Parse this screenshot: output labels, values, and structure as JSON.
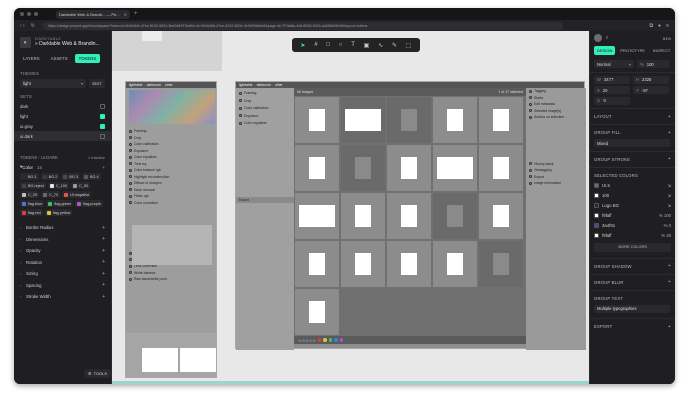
{
  "browser": {
    "tab_title": "Darktable Web & Brandi... — Pe...",
    "url": "https://design.penpot.app/#/workspace?team-id=0b3a3b6-47ee-8102-8004-3be0d9937bafile-id=0b3a3b6-47ee-8102-8004-4e3d99bfcbf4&page-id=7f7da8a-4e8-8005-8004-a4658b0fe0b&layout=tokens"
  },
  "project": {
    "org": "DARKTABLE",
    "name": "» Darktable Web & Brandin..."
  },
  "left_tabs": [
    "LAYERS",
    "ASSETS",
    "TOKENS"
  ],
  "themes": {
    "label": "THEMES",
    "selected": "light",
    "edit": "EDIT"
  },
  "sets": {
    "label": "SETS",
    "items": [
      {
        "name": "dark",
        "checked": false
      },
      {
        "name": "light",
        "checked": true
      },
      {
        "name": "ui.gray",
        "checked": true
      },
      {
        "name": "ui.dark",
        "checked": false
      }
    ]
  },
  "tokens": {
    "label": "TOKENS - UI.DARK",
    "state": "Inactive",
    "color_group": "Color",
    "color_count": "15",
    "pills": [
      {
        "name": "BG.1",
        "color": "#2b2b2b"
      },
      {
        "name": "BG.2",
        "color": "#3a3a3a"
      },
      {
        "name": "BG.3",
        "color": "#4a4a4a"
      },
      {
        "name": "BG.4",
        "color": "#5a5a5a"
      },
      {
        "name": "BG.reject",
        "color": "#444444"
      },
      {
        "name": "C_100",
        "color": "#e8e8e8"
      },
      {
        "name": "C_50",
        "color": "#9a9a9a"
      },
      {
        "name": "C_25",
        "color": "#c0c0c0"
      },
      {
        "name": "C_70",
        "color": "#6a6a6a"
      },
      {
        "name": "UI.negative",
        "color": "#e25555"
      },
      {
        "name": "flag.blue",
        "color": "#3f7ce0"
      },
      {
        "name": "flag.green",
        "color": "#3ec25a"
      },
      {
        "name": "flag.purple",
        "color": "#b44fd6"
      },
      {
        "name": "flag.red",
        "color": "#e03d3d"
      },
      {
        "name": "flag.yellow",
        "color": "#e0c23d"
      }
    ],
    "groups": [
      "Border Radius",
      "Dimensions",
      "Opacity",
      "Rotation",
      "Sizing",
      "Spacing",
      "Stroke Width"
    ]
  },
  "tools_button": "TOOLS",
  "canvas": {
    "toolbar_icons": [
      "pointer-icon",
      "frame-icon",
      "rect-icon",
      "ellipse-icon",
      "text-icon",
      "image-icon",
      "curve-icon",
      "path-icon",
      "plugin-icon"
    ],
    "left_panel_modules": [
      "Framing",
      "Crop",
      "Color calibration",
      "Exposure",
      "Color equalizer",
      "Tone eq.",
      "Color balance rgb",
      "Highlight reconstruction",
      "Diffuse or sharpen",
      "Haze removal",
      "Filmic rgb",
      "Color correction",
      "Composite",
      "Denoise (profiled)",
      "Lens correction",
      "White balance",
      "Raw black/white point"
    ],
    "right_panel_modules": [
      "Tagging",
      "Styles",
      "Edit metadata",
      "Selected image[s]",
      "Actions on selection",
      "History stack",
      "Geotagging",
      "Export",
      "Image information"
    ],
    "grid_header": "1 of 17 selected",
    "image_count_label": "All images",
    "export_label": "Export"
  },
  "right_panel": {
    "zoom": "81%",
    "tabs": [
      "DESIGN",
      "PROTOTYPE",
      "INSPECT"
    ],
    "layout_mode": "Normal",
    "opacity": "100",
    "w": "3477",
    "h": "2328",
    "x": "20",
    "y": "-97",
    "rotation": "0",
    "layout_header": "LAYOUT",
    "fill_header": "GROUP FILL",
    "fill_value": "Mixed",
    "stroke_header": "GROUP STROKE",
    "selected_colors_header": "SELECTED COLORS",
    "colors": [
      {
        "name": "UI.5",
        "color": "#6b6b6b",
        "op": ""
      },
      {
        "name": "100",
        "color": "#ffffff",
        "op": ""
      },
      {
        "name": "Logo BG",
        "color": "#2a2a2a",
        "op": ""
      },
      {
        "name": "f9faff",
        "color": "#f9faff",
        "op": "100"
      },
      {
        "name": "3a4f91",
        "color": "#3a4f91",
        "op": "0"
      },
      {
        "name": "f9faff",
        "color": "#f9faff",
        "op": "49"
      }
    ],
    "more_colors": "MORE COLORS",
    "shadow_header": "GROUP SHADOW",
    "blur_header": "GROUP BLUR",
    "text_header": "GROUP TEXT",
    "text_value": "Multiple typographies",
    "export_header": "EXPORT"
  }
}
